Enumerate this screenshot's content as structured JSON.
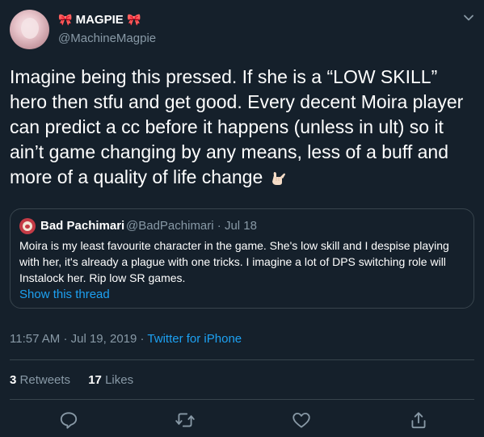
{
  "user": {
    "display_name": "MAGPIE",
    "name_decoration": "🎀",
    "handle": "@MachineMagpie"
  },
  "tweet": {
    "text": "Imagine being this pressed. If she is a “LOW SKILL” hero then stfu and get good. Every decent Moira player can predict a cc before it happens (unless in ult) so it ain’t game changing by any means, less of a buff and more of a quality of life change",
    "emoji": "call-me-hand-emoji"
  },
  "quoted_tweet": {
    "name": "Bad Pachimari",
    "handle": "@BadPachimari",
    "separator": "·",
    "date": "Jul 18",
    "text": "Moira is my least favourite character in the game. She's low skill and I despise playing with her, it's already a plague with one tricks. I imagine a lot of DPS switching role will Instalock her. Rip low SR games.",
    "show_thread_label": "Show this thread"
  },
  "meta": {
    "time": "11:57 AM",
    "separator": "·",
    "date": "Jul 19, 2019",
    "source": "Twitter for iPhone"
  },
  "stats": {
    "retweets_count": "3",
    "retweets_label": "Retweets",
    "likes_count": "17",
    "likes_label": "Likes"
  },
  "actions": [
    "reply-icon",
    "retweet-icon",
    "like-icon",
    "share-icon"
  ],
  "colors": {
    "background": "#15202b",
    "text": "#ffffff",
    "secondary": "#8899a6",
    "accent": "#1da1f2",
    "border": "#38444d",
    "bow": "#e0245e"
  }
}
